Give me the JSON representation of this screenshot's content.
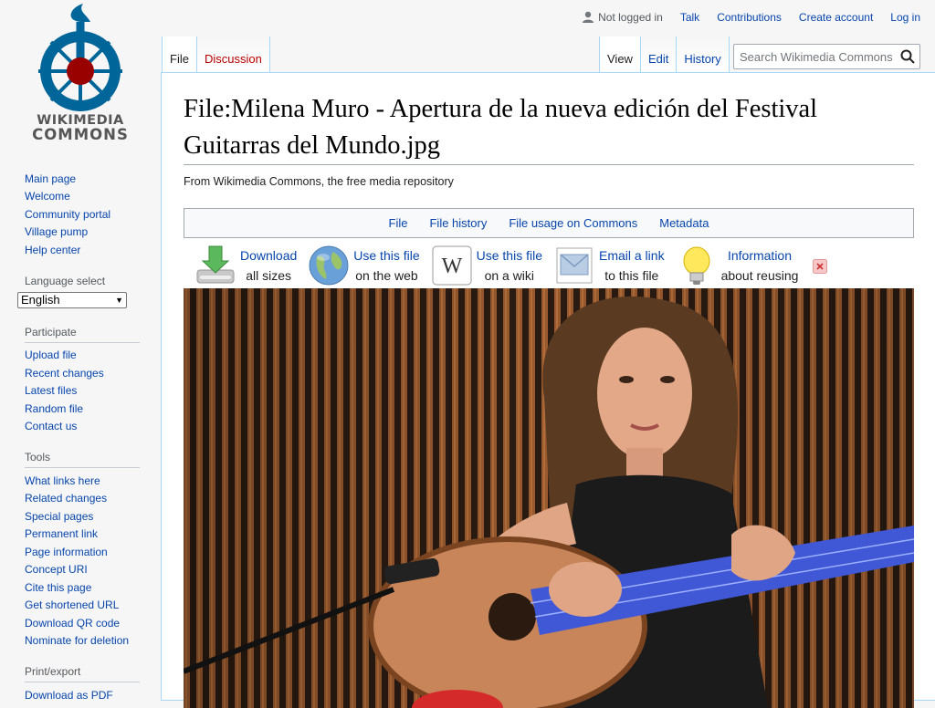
{
  "logo": {
    "line1": "WIKIMEDIA",
    "line2": "COMMONS"
  },
  "personal_tools": {
    "not_logged_in": "Not logged in",
    "items": [
      "Talk",
      "Contributions",
      "Create account",
      "Log in"
    ]
  },
  "tabs": {
    "left": [
      {
        "label": "File"
      },
      {
        "label": "Discussion"
      }
    ],
    "right": [
      {
        "label": "View"
      },
      {
        "label": "Edit"
      },
      {
        "label": "History"
      }
    ]
  },
  "search": {
    "placeholder": "Search Wikimedia Commons"
  },
  "sidebar": {
    "navigation": [
      "Main page",
      "Welcome",
      "Community portal",
      "Village pump",
      "Help center"
    ],
    "language": {
      "heading": "Language select",
      "selected": "English"
    },
    "participate": {
      "heading": "Participate",
      "items": [
        "Upload file",
        "Recent changes",
        "Latest files",
        "Random file",
        "Contact us"
      ]
    },
    "tools": {
      "heading": "Tools",
      "items": [
        "What links here",
        "Related changes",
        "Special pages",
        "Permanent link",
        "Page information",
        "Concept URI",
        "Cite this page",
        "Get shortened URL",
        "Download QR code",
        "Nominate for deletion"
      ]
    },
    "print": {
      "heading": "Print/export",
      "items": [
        "Download as PDF"
      ]
    }
  },
  "page": {
    "title": "File:Milena Muro - Apertura de la nueva edición del Festival Guitarras del Mundo.jpg",
    "tagline": "From Wikimedia Commons, the free media repository"
  },
  "filetoc": [
    "File",
    "File history",
    "File usage on Commons",
    "Metadata"
  ],
  "actions": [
    {
      "icon": "download-icon",
      "line1": "Download",
      "line2": "all sizes"
    },
    {
      "icon": "globe-icon",
      "line1": "Use this file",
      "line2": "on the web"
    },
    {
      "icon": "wikipedia-icon",
      "line1": "Use this file",
      "line2": "on a wiki"
    },
    {
      "icon": "email-icon",
      "line1": "Email a link",
      "line2": "to this file"
    },
    {
      "icon": "lightbulb-icon",
      "line1": "Information",
      "line2": "about reusing"
    }
  ],
  "colors": {
    "link": "#0645ad",
    "redlink": "#ba0000",
    "tab_border": "#a7d7f9"
  }
}
